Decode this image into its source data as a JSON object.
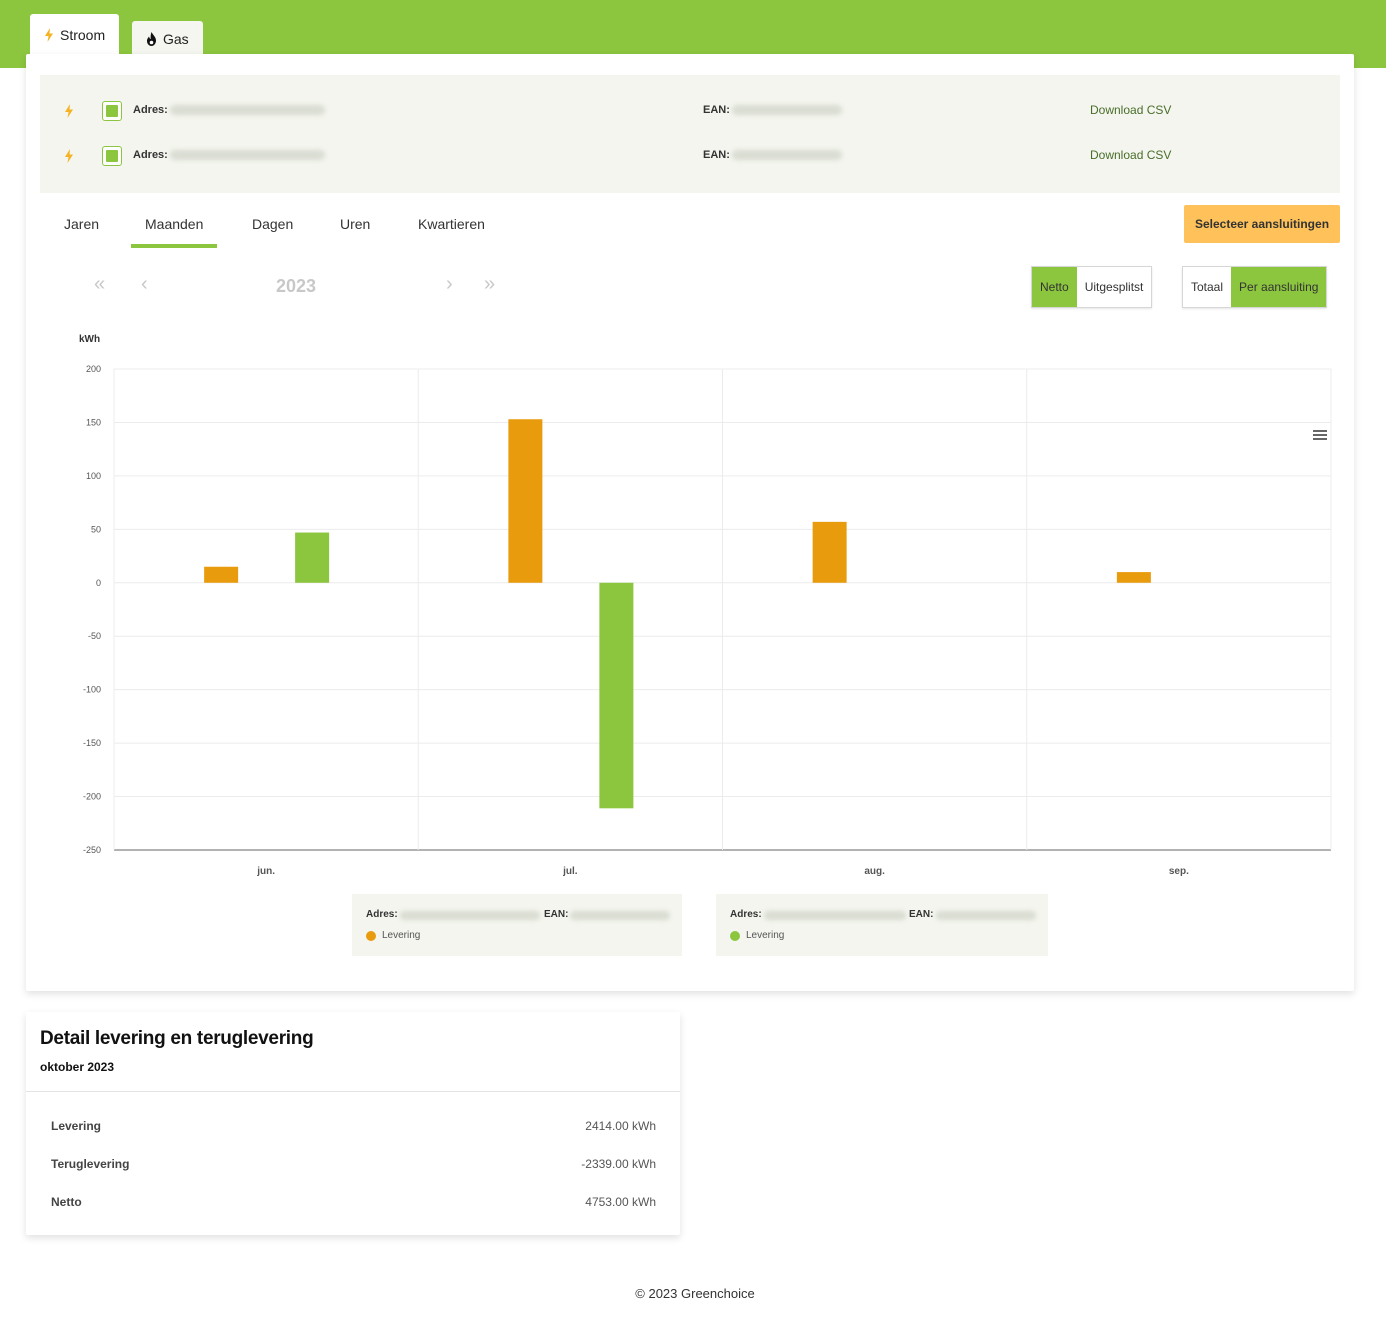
{
  "tabs": {
    "stroom": {
      "label": "Stroom",
      "icon": "bolt-icon"
    },
    "gas": {
      "label": "Gas",
      "icon": "flame-icon"
    }
  },
  "connections": [
    {
      "adres_label": "Adres:",
      "ean_label": "EAN:",
      "download_label": "Download CSV"
    },
    {
      "adres_label": "Adres:",
      "ean_label": "EAN:",
      "download_label": "Download CSV"
    }
  ],
  "period_tabs": [
    {
      "label": "Jaren"
    },
    {
      "label": "Maanden"
    },
    {
      "label": "Dagen"
    },
    {
      "label": "Uren"
    },
    {
      "label": "Kwartieren"
    }
  ],
  "select_button": "Selecteer aansluitingen",
  "navigation": {
    "year": "2023",
    "first": "«",
    "prev": "‹",
    "next": "›",
    "last": "»"
  },
  "toggles": {
    "netto": "Netto",
    "uitgesplitst": "Uitgesplitst",
    "totaal": "Totaal",
    "per_aansluiting": "Per aansluiting"
  },
  "colors": {
    "brand_green": "#8cc63f",
    "orange_series": "#e99b0e",
    "select_button": "#ffc25a"
  },
  "chart_data": {
    "type": "bar",
    "ylabel": "kWh",
    "xlabel": "",
    "title": "",
    "ylim": [
      -250,
      200
    ],
    "yticks": [
      200,
      150,
      100,
      50,
      0,
      -50,
      -100,
      -150,
      -200,
      -250
    ],
    "categories": [
      "jun.",
      "jul.",
      "aug.",
      "sep."
    ],
    "series": [
      {
        "values": [
          15,
          153,
          57,
          10
        ],
        "color": "#e99b0e"
      },
      {
        "values": [
          47,
          -211,
          0,
          0
        ],
        "color": "#8cc63f"
      }
    ],
    "grid": true,
    "menu_icon": "hamburger-icon"
  },
  "legend": [
    {
      "adres_label": "Adres:",
      "ean_label": "EAN:",
      "item": "Levering",
      "color": "#e99b0e"
    },
    {
      "adres_label": "Adres:",
      "ean_label": "EAN:",
      "item": "Levering",
      "color": "#8cc63f"
    }
  ],
  "detail": {
    "title": "Detail levering en teruglevering",
    "subtitle": "oktober 2023",
    "rows": [
      {
        "label": "Levering",
        "value": "2414.00 kWh"
      },
      {
        "label": "Teruglevering",
        "value": "-2339.00 kWh"
      },
      {
        "label": "Netto",
        "value": "4753.00 kWh"
      }
    ]
  },
  "footer": "© 2023 Greenchoice"
}
